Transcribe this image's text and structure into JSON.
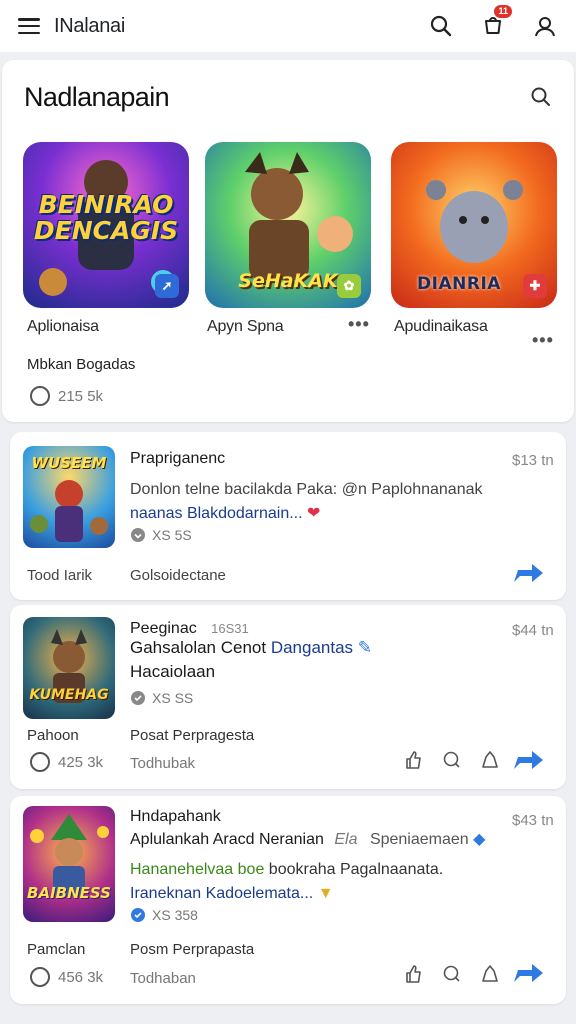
{
  "topbar": {
    "title": "INalanai",
    "cart_badge": "11"
  },
  "featured": {
    "title": "Nadlanapain",
    "tiles": [
      {
        "art_title": "BEINIRAO DENCAGIS",
        "label": "Aplionaisa"
      },
      {
        "art_title": "SeHaKAK",
        "label": "Apyn Spna"
      },
      {
        "art_title": "DIANRIA",
        "label": "Apudinaikasa"
      }
    ],
    "subtitle": "Mbkan Bogadas",
    "count": "215 5k"
  },
  "posts": [
    {
      "art_title": "WUSEEM",
      "title": "Prapriganenc",
      "time": "$13 tn",
      "desc_line1": "Donlon telne bacilakda Paka: @n Paplohnananak",
      "desc_line2": "naanas Blakdodarnain...",
      "stat": "XS 5S",
      "foot_left": "Tood Iarik",
      "foot_mid": "Golsoidectane"
    },
    {
      "art_title": "KUMEHAG",
      "title": "Peeginac",
      "title_meta": "16S31",
      "time": "$44 tn",
      "desc_line1a": "Gahsalolan Cenot",
      "desc_line1b": "Dangantas",
      "desc_line2": "Hacaiolaan",
      "stat": "XS SS",
      "foot_left": "Pahoon",
      "foot_mid": "Posat Perpragesta",
      "count": "425 3k",
      "count_label": "Todhubak"
    },
    {
      "art_title": "BAIBNESS",
      "title": "Hndapahank",
      "title2": "Aplulankah Aracd Neranian",
      "title2_meta": "Ela",
      "title2_tag": "Speniaemaen",
      "time": "$43 tn",
      "desc_line1": "Hananehelvaa boe",
      "desc_line1b": "bookraha Pagalnaanata.",
      "desc_line2": "Iraneknan Kadoelemata...",
      "stat": "XS 358",
      "foot_left": "Pamclan",
      "foot_mid": "Posm Perprapasta",
      "count": "456 3k",
      "count_label": "Todhaban"
    }
  ]
}
